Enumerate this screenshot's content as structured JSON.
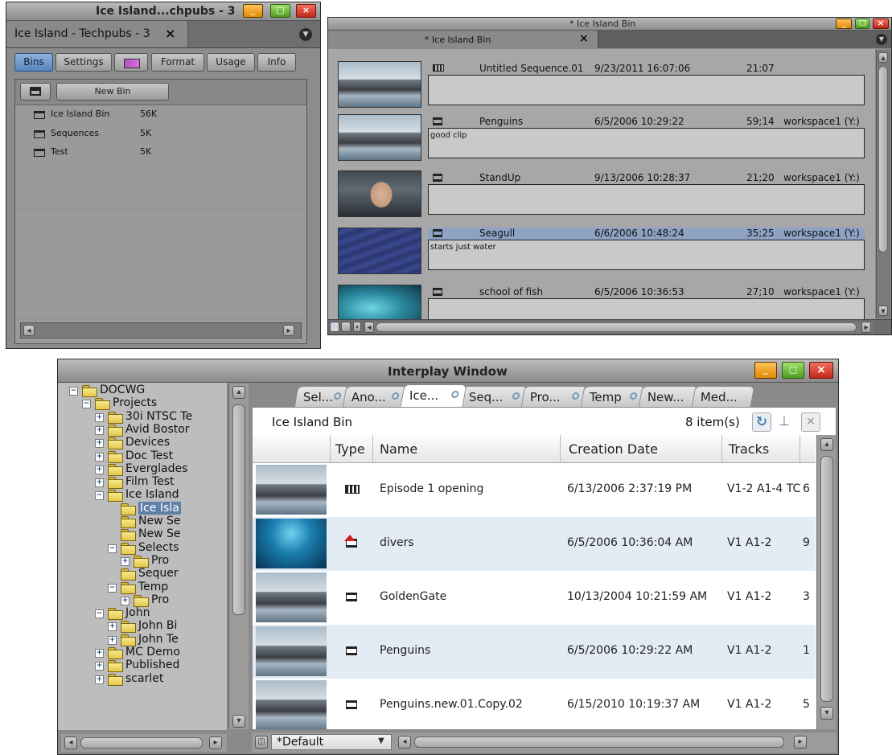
{
  "project_window": {
    "title": "Ice Island...chpubs - 3",
    "tab_label": "Ice Island - Techpubs - 3",
    "tab_close": "×",
    "tabs": [
      "Bins",
      "Settings",
      "",
      "Format",
      "Usage",
      "Info"
    ],
    "new_bin_label": "New Bin",
    "bins": [
      {
        "name": "Ice Island Bin",
        "size": "56K"
      },
      {
        "name": "Sequences",
        "size": "5K"
      },
      {
        "name": "Test",
        "size": "5K"
      }
    ],
    "scroll_left": "◂",
    "scroll_right": "▸"
  },
  "bin_window": {
    "title": "* Ice Island Bin",
    "tab_label": "* Ice Island Bin",
    "tab_close": "×",
    "clips": [
      {
        "name": "Untitled Sequence.01",
        "date": "9/23/2011 16:07:06",
        "duration": "21:07",
        "drive": "",
        "comment": "",
        "thumb": "penguins"
      },
      {
        "name": "Penguins",
        "date": "6/5/2006 10:29:22",
        "duration": "59;14",
        "drive": "workspace1 (Y:)",
        "comment": "good clip",
        "thumb": "penguins"
      },
      {
        "name": "StandUp",
        "date": "9/13/2006 10:28:37",
        "duration": "21;20",
        "drive": "workspace1 (Y:)",
        "comment": "",
        "thumb": "standup"
      },
      {
        "name": "Seagull",
        "date": "6/6/2006 10:48:24",
        "duration": "35;25",
        "drive": "workspace1 (Y:)",
        "comment": "starts just water",
        "thumb": "sea"
      },
      {
        "name": "school of fish",
        "date": "6/5/2006 10:36:53",
        "duration": "27;10",
        "drive": "workspace1 (Y:)",
        "comment": "",
        "thumb": "fish"
      }
    ]
  },
  "interplay_window": {
    "title": "Interplay Window",
    "tree": [
      {
        "label": "DOCWG",
        "level": 0,
        "expander": "-"
      },
      {
        "label": "Projects",
        "level": 1,
        "expander": "-"
      },
      {
        "label": "30i NTSC Te",
        "level": 2,
        "expander": "+"
      },
      {
        "label": "Avid Bostor",
        "level": 2,
        "expander": "+"
      },
      {
        "label": "Devices",
        "level": 2,
        "expander": "+"
      },
      {
        "label": "Doc Test",
        "level": 2,
        "expander": "+"
      },
      {
        "label": "Everglades",
        "level": 2,
        "expander": "+"
      },
      {
        "label": "Film Test",
        "level": 2,
        "expander": "+"
      },
      {
        "label": "Ice Island",
        "level": 2,
        "expander": "-"
      },
      {
        "label": "Ice Isla",
        "level": 3,
        "expander": "",
        "selected": true
      },
      {
        "label": "New Se",
        "level": 3,
        "expander": ""
      },
      {
        "label": "New Se",
        "level": 3,
        "expander": ""
      },
      {
        "label": "Selects",
        "level": 3,
        "expander": "-"
      },
      {
        "label": "Pro",
        "level": 4,
        "expander": "+"
      },
      {
        "label": "Sequer",
        "level": 3,
        "expander": ""
      },
      {
        "label": "Temp",
        "level": 3,
        "expander": "-"
      },
      {
        "label": "Pro",
        "level": 4,
        "expander": "+"
      },
      {
        "label": "John",
        "level": 2,
        "expander": "-"
      },
      {
        "label": "John Bi",
        "level": 3,
        "expander": "+"
      },
      {
        "label": "John Te",
        "level": 3,
        "expander": "+"
      },
      {
        "label": "MC Demo",
        "level": 2,
        "expander": "+"
      },
      {
        "label": "Published",
        "level": 2,
        "expander": "+"
      },
      {
        "label": "scarlet",
        "level": 2,
        "expander": "+"
      }
    ],
    "tabs": [
      "Sel...",
      "Ano...",
      "Ice...",
      "Seq...",
      "Pro...",
      "Temp",
      "New...",
      "Med..."
    ],
    "active_tab": 2,
    "bin_name": "Ice Island Bin",
    "item_count": "8 item(s)",
    "columns": [
      "Type",
      "Name",
      "Creation Date",
      "Tracks"
    ],
    "rows": [
      {
        "name": "Episode 1 opening",
        "date": "6/13/2006 2:37:19 PM",
        "tracks": "V1-2 A1-4 TC",
        "extra": "6",
        "type": "sequence",
        "thumb": "penguins"
      },
      {
        "name": "divers",
        "date": "6/5/2006 10:36:04 AM",
        "tracks": "V1 A1-2",
        "extra": "9",
        "type": "clip-red",
        "thumb": "divers"
      },
      {
        "name": "GoldenGate",
        "date": "10/13/2004 10:21:59 AM",
        "tracks": "V1 A1-2",
        "extra": "3",
        "type": "clip",
        "thumb": "penguins"
      },
      {
        "name": "Penguins",
        "date": "6/5/2006 10:29:22 AM",
        "tracks": "V1 A1-2",
        "extra": "1",
        "type": "clip",
        "thumb": "penguins"
      },
      {
        "name": "Penguins.new.01.Copy.02",
        "date": "6/15/2010 10:19:37 AM",
        "tracks": "V1 A1-2",
        "extra": "5",
        "type": "clip",
        "thumb": "penguins"
      }
    ],
    "view_select": "*Default"
  }
}
